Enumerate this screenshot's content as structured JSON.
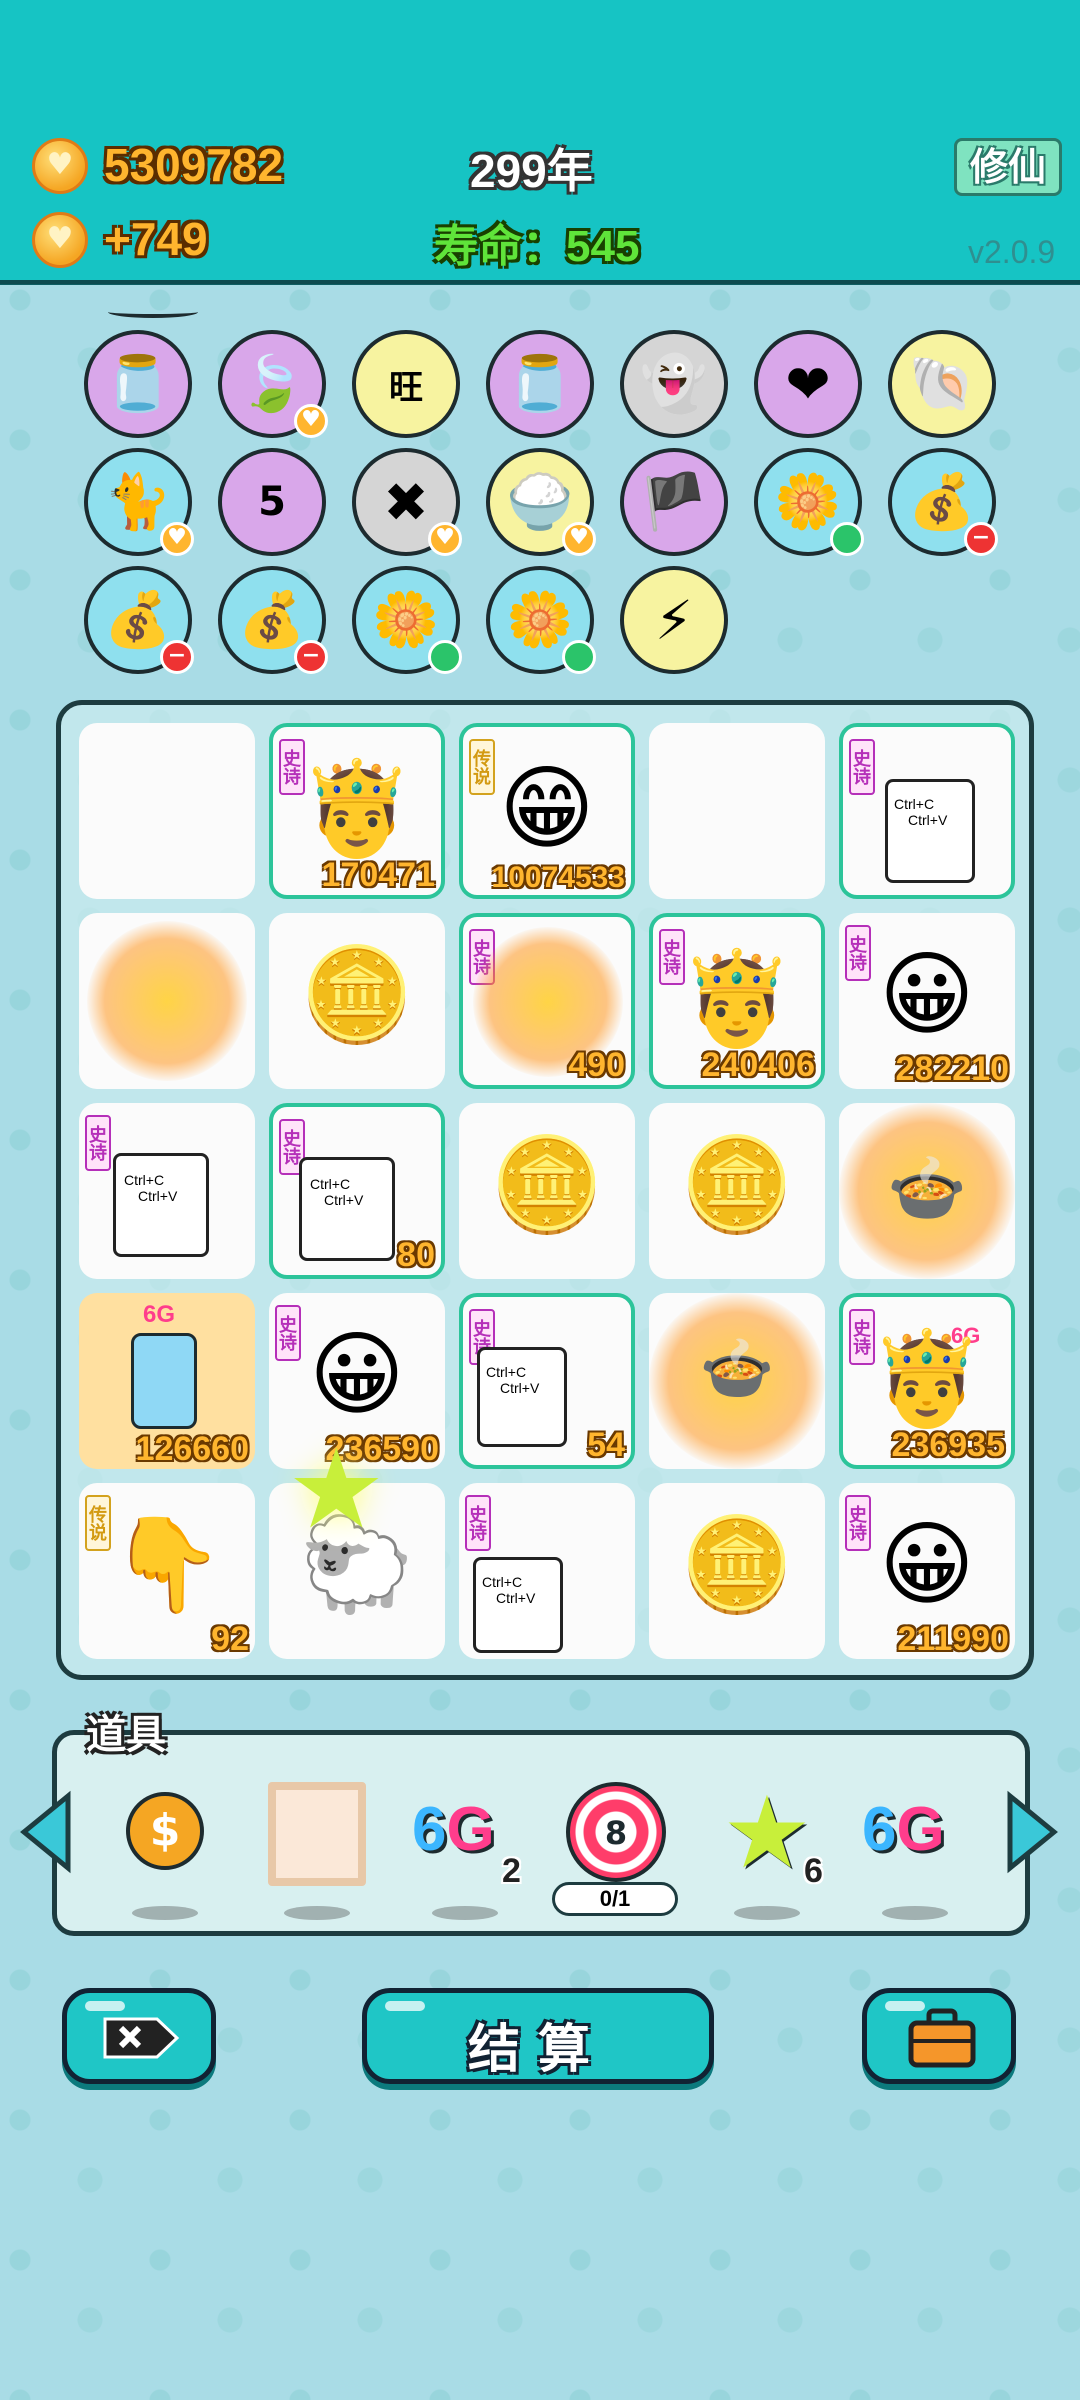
{
  "header": {
    "coins": "5309782",
    "income": "+749",
    "year": "299年",
    "lifespan": "寿命：545",
    "xiuxian_label": "修仙",
    "version": "v2.0.9"
  },
  "symbols": {
    "row1": [
      "jar",
      "leaf",
      "wang-tile",
      "jar",
      "ghost",
      "heart-bag",
      "shell"
    ],
    "row2": [
      "cat",
      "calendar",
      "delete-tag",
      "rice-bowl",
      "eyepatch",
      "flower-pot",
      "money-bag"
    ],
    "row3": [
      "money-bag",
      "money-bag",
      "flower-pot",
      "flower-pot",
      "lightning"
    ],
    "wang_char": "旺",
    "calendar_day": "5"
  },
  "board": {
    "tags": {
      "epic": "史诗",
      "legend": "传说"
    },
    "copy_paste": [
      "Ctrl+C",
      "Ctrl+V"
    ],
    "g6_label": "6G",
    "tiles": [
      {
        "value": ""
      },
      {
        "value": "170471"
      },
      {
        "value": "10074533"
      },
      {
        "value": ""
      },
      {
        "value": ""
      },
      {
        "value": ""
      },
      {
        "value": ""
      },
      {
        "value": "490"
      },
      {
        "value": "240406"
      },
      {
        "value": "282210"
      },
      {
        "value": ""
      },
      {
        "value": "80"
      },
      {
        "value": ""
      },
      {
        "value": ""
      },
      {
        "value": ""
      },
      {
        "value": "126660"
      },
      {
        "value": "236590"
      },
      {
        "value": "54"
      },
      {
        "value": ""
      },
      {
        "value": "236935"
      },
      {
        "value": "92"
      },
      {
        "value": ""
      },
      {
        "value": ""
      },
      {
        "value": ""
      },
      {
        "value": "211990"
      }
    ]
  },
  "tools": {
    "title": "道具",
    "g6_label_a": "6",
    "g6_label_b": "G",
    "count_6g": "2",
    "target_number": "8",
    "target_counter": "0/1",
    "count_star": "6"
  },
  "buttons": {
    "settle_label": "结算"
  }
}
